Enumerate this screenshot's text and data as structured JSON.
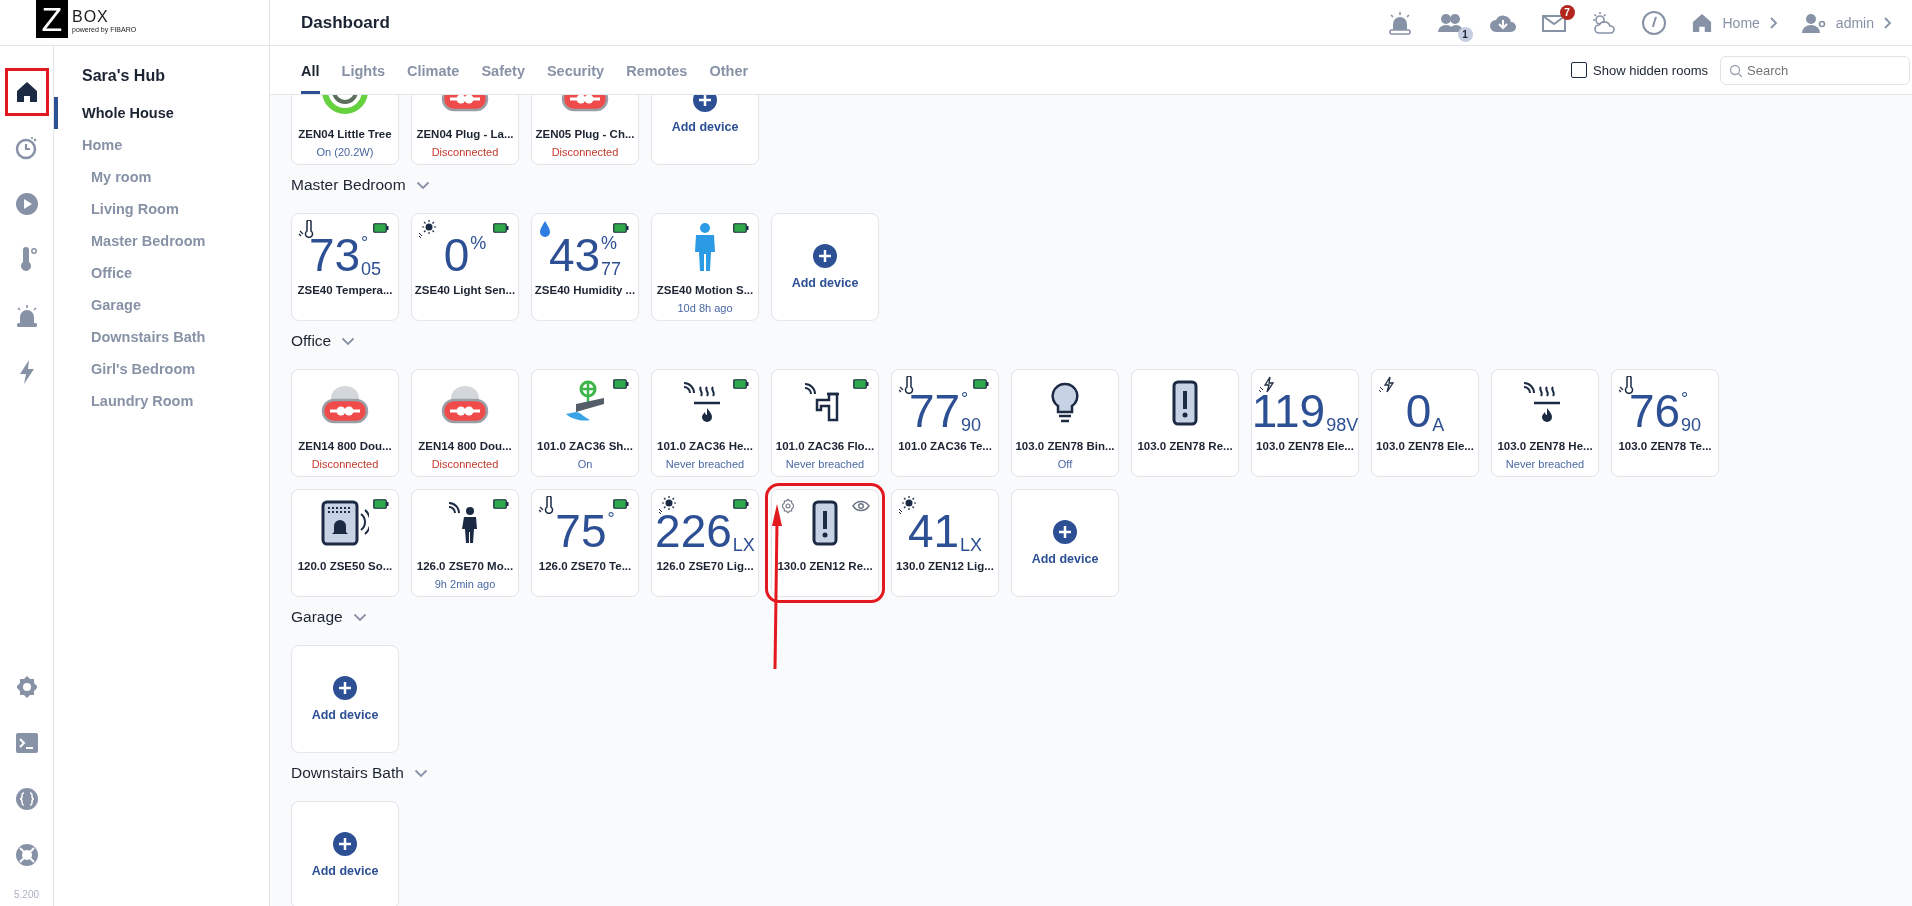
{
  "logo": {
    "letter": "Z",
    "text": "BOX",
    "tagline": "powered by FIBARO"
  },
  "header": {
    "title": "Dashboard",
    "icons": [
      {
        "kind": "alarm"
      },
      {
        "kind": "users",
        "badge": "1"
      },
      {
        "kind": "cloud"
      },
      {
        "kind": "mail",
        "badge": "7"
      },
      {
        "kind": "weather"
      },
      {
        "kind": "clock"
      }
    ],
    "home_link": "Home",
    "user_link": "admin"
  },
  "rail": {
    "items": [
      {
        "kind": "home",
        "selected": true,
        "annotated": true
      },
      {
        "kind": "history",
        "selected": false,
        "annotated": false
      },
      {
        "kind": "play",
        "selected": false,
        "annotated": false
      },
      {
        "kind": "thermometer",
        "selected": false,
        "annotated": false
      },
      {
        "kind": "alarm",
        "selected": false,
        "annotated": false
      },
      {
        "kind": "bolt",
        "selected": false,
        "annotated": false
      }
    ],
    "bottom_items": [
      {
        "kind": "settings"
      },
      {
        "kind": "terminal"
      },
      {
        "kind": "braces"
      },
      {
        "kind": "help"
      }
    ],
    "version": "5.200"
  },
  "sidebar": {
    "hub": "Sara's Hub",
    "items": [
      {
        "label": "Whole House",
        "selected": true
      },
      {
        "label": "Home",
        "selected": false,
        "children": [
          {
            "label": "My room",
            "selected": false
          },
          {
            "label": "Living Room",
            "selected": false
          },
          {
            "label": "Master Bedroom",
            "selected": false
          },
          {
            "label": "Office",
            "selected": false
          },
          {
            "label": "Garage",
            "selected": false
          },
          {
            "label": "Downstairs Bath",
            "selected": false
          },
          {
            "label": "Girl's Bedroom",
            "selected": false
          },
          {
            "label": "Laundry Room",
            "selected": false
          }
        ]
      }
    ]
  },
  "tabs": [
    {
      "label": "All",
      "selected": true
    },
    {
      "label": "Lights",
      "selected": false
    },
    {
      "label": "Climate",
      "selected": false
    },
    {
      "label": "Safety",
      "selected": false
    },
    {
      "label": "Security",
      "selected": false
    },
    {
      "label": "Remotes",
      "selected": false
    },
    {
      "label": "Other",
      "selected": false
    }
  ],
  "show_hidden": {
    "label": "Show hidden rooms",
    "checked": false
  },
  "search": {
    "placeholder": "Search"
  },
  "sections": [
    {
      "expanded": true,
      "devices": [
        {
          "kind": "switch",
          "name": "ZEN04 Little Tree",
          "status": "On (20.2W)",
          "status_error": false,
          "annotated": false
        },
        {
          "kind": "plug",
          "name": "ZEN04 Plug - La...",
          "status": "Disconnected",
          "status_error": true,
          "annotated": false
        },
        {
          "kind": "plug",
          "name": "ZEN05 Plug - Ch...",
          "status": "Disconnected",
          "status_error": true,
          "annotated": false
        },
        {
          "kind": "add",
          "name": "Add device"
        }
      ]
    },
    {
      "title": "Master Bedroom",
      "expanded": true,
      "devices": [
        {
          "kind": "temperature",
          "value": "73",
          "decimal": "05",
          "unit": "°",
          "unit_raised": true,
          "name": "ZSE40 Tempera...",
          "battery": true,
          "hovered": false,
          "annotated": false
        },
        {
          "kind": "light",
          "value": "0",
          "unit": "%",
          "unit_raised": true,
          "name": "ZSE40 Light Sen...",
          "battery": true,
          "hovered": false,
          "annotated": false
        },
        {
          "kind": "humidity",
          "value": "43",
          "decimal": "77",
          "unit": "%",
          "unit_raised": true,
          "name": "ZSE40 Humidity ...",
          "battery": true,
          "hovered": false,
          "annotated": false
        },
        {
          "kind": "person",
          "name": "ZSE40 Motion S...",
          "status": "10d 8h ago",
          "status_error": false,
          "battery": true,
          "hovered": false,
          "annotated": false
        },
        {
          "kind": "add",
          "name": "Add device"
        }
      ]
    },
    {
      "title": "Office",
      "expanded": true,
      "devices": [
        {
          "kind": "plug",
          "name": "ZEN14 800 Dou...",
          "status": "Disconnected",
          "status_error": true,
          "battery": false,
          "hovered": false,
          "annotated": false
        },
        {
          "kind": "plug",
          "name": "ZEN14 800 Dou...",
          "status": "Disconnected",
          "status_error": true,
          "battery": false,
          "hovered": false,
          "annotated": false
        },
        {
          "kind": "valve",
          "name": "101.0 ZAC36 Sh...",
          "status": "On",
          "status_error": false,
          "battery": true,
          "hovered": false,
          "annotated": false
        },
        {
          "kind": "heat",
          "name": "101.0 ZAC36 He...",
          "status": "Never breached",
          "status_error": false,
          "battery": true,
          "hovered": false,
          "annotated": false
        },
        {
          "kind": "faucet",
          "name": "101.0 ZAC36 Flo...",
          "status": "Never breached",
          "status_error": false,
          "battery": true,
          "hovered": false,
          "annotated": false
        },
        {
          "kind": "temperature",
          "value": "77",
          "decimal": "90",
          "unit": "°",
          "unit_raised": true,
          "name": "101.0 ZAC36 Te...",
          "battery": true,
          "hovered": false,
          "annotated": false
        },
        {
          "kind": "bulb",
          "name": "103.0 ZEN78 Bin...",
          "status": "Off",
          "status_error": false,
          "battery": false,
          "hovered": false,
          "annotated": false
        },
        {
          "kind": "relay",
          "name": "103.0 ZEN78 Re...",
          "battery": false,
          "hovered": false,
          "annotated": false
        },
        {
          "kind": "voltage",
          "value": "119",
          "decimal": "98",
          "unit": "V",
          "unit_raised": false,
          "name": "103.0 ZEN78 Ele...",
          "battery": false,
          "hovered": false,
          "annotated": false
        },
        {
          "kind": "current",
          "value": "0",
          "unit": "A",
          "unit_raised": false,
          "name": "103.0 ZEN78 Ele...",
          "battery": false,
          "hovered": false,
          "annotated": false
        },
        {
          "kind": "heat",
          "name": "103.0 ZEN78 He...",
          "status": "Never breached",
          "status_error": false,
          "battery": false,
          "hovered": false,
          "annotated": false
        },
        {
          "kind": "temperature",
          "value": "76",
          "decimal": "90",
          "unit": "°",
          "unit_raised": true,
          "name": "103.0 ZEN78 Te...",
          "battery": false,
          "hovered": false,
          "annotated": false
        },
        {
          "kind": "siren",
          "name": "120.0 ZSE50 So...",
          "battery": true,
          "hovered": false,
          "annotated": false
        },
        {
          "kind": "walker",
          "name": "126.0 ZSE70 Mo...",
          "status": "9h 2min ago",
          "status_error": false,
          "battery": true,
          "hovered": false,
          "annotated": false
        },
        {
          "kind": "temperature",
          "value": "75",
          "unit": "°",
          "unit_raised": true,
          "name": "126.0 ZSE70 Te...",
          "battery": true,
          "hovered": false,
          "annotated": false
        },
        {
          "kind": "light",
          "value": "226",
          "unit": "LX",
          "unit_raised": false,
          "name": "126.0 ZSE70 Lig...",
          "battery": true,
          "hovered": false,
          "annotated": false
        },
        {
          "kind": "relay",
          "name": "130.0 ZEN12 Re...",
          "battery": false,
          "hovered": true,
          "annotated": true
        },
        {
          "kind": "light",
          "value": "41",
          "unit": "LX",
          "unit_raised": false,
          "name": "130.0 ZEN12 Lig...",
          "battery": false,
          "hovered": false,
          "annotated": false
        },
        {
          "kind": "add",
          "name": "Add device"
        }
      ]
    },
    {
      "title": "Garage",
      "expanded": true,
      "devices": [
        {
          "kind": "add",
          "name": "Add device"
        }
      ]
    },
    {
      "title": "Downstairs Bath",
      "expanded": true,
      "devices": [
        {
          "kind": "add",
          "name": "Add device"
        }
      ]
    }
  ]
}
